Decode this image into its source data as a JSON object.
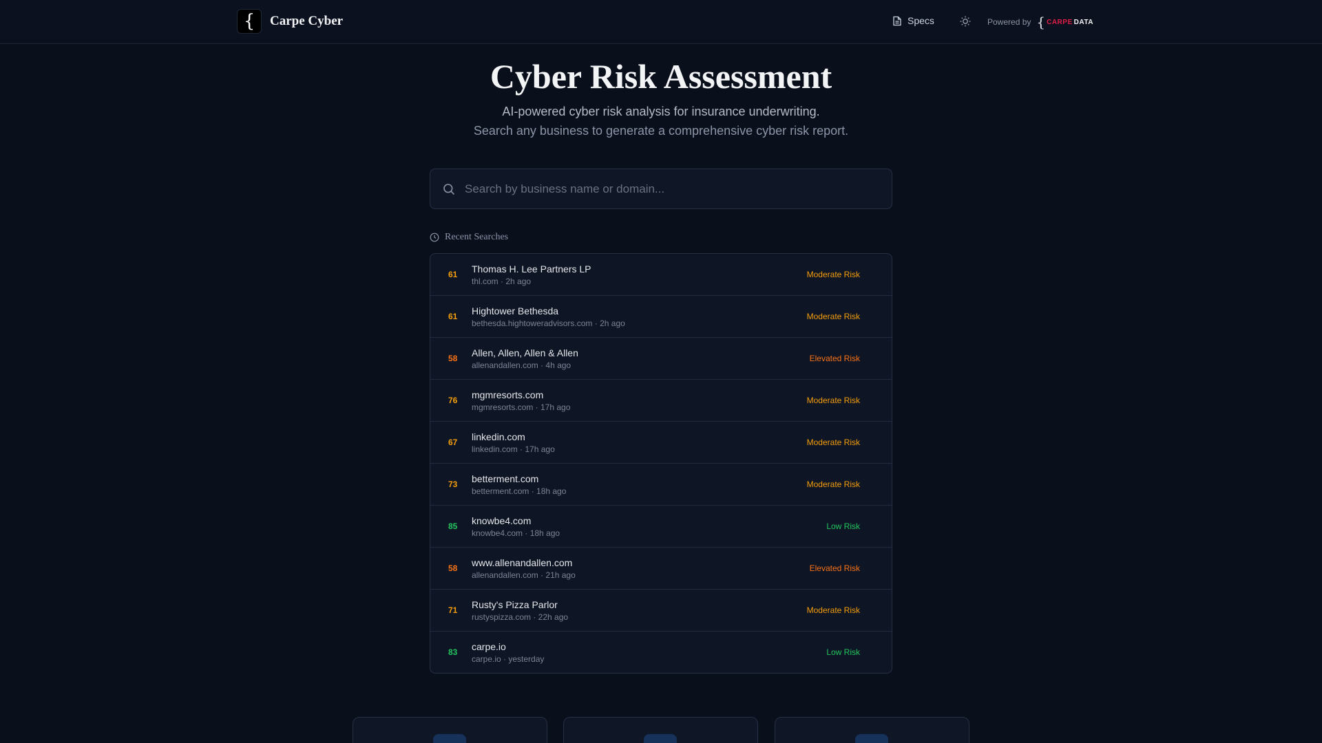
{
  "header": {
    "brand_mark": "{",
    "brand_name": "Carpe Cyber",
    "specs_label": "Specs",
    "powered_by": "Powered by",
    "powered_logo_brace": "{",
    "powered_logo_carpe": "CARPE",
    "powered_logo_data": "DATA"
  },
  "hero": {
    "title": "Cyber Risk Assessment",
    "subtitle_1": "AI-powered cyber risk analysis for insurance underwriting.",
    "subtitle_2": "Search any business to generate a comprehensive cyber risk report."
  },
  "search": {
    "placeholder": "Search by business name or domain...",
    "value": ""
  },
  "recent": {
    "label": "Recent Searches",
    "items": [
      {
        "score": "61",
        "name": "Thomas H. Lee Partners LP",
        "meta": "thl.com · 2h ago",
        "risk": "Moderate Risk"
      },
      {
        "score": "61",
        "name": "Hightower Bethesda",
        "meta": "bethesda.hightoweradvisors.com · 2h ago",
        "risk": "Moderate Risk"
      },
      {
        "score": "58",
        "name": "Allen, Allen, Allen & Allen",
        "meta": "allenandallen.com · 4h ago",
        "risk": "Elevated Risk"
      },
      {
        "score": "76",
        "name": "mgmresorts.com",
        "meta": "mgmresorts.com · 17h ago",
        "risk": "Moderate Risk"
      },
      {
        "score": "67",
        "name": "linkedin.com",
        "meta": "linkedin.com · 17h ago",
        "risk": "Moderate Risk"
      },
      {
        "score": "73",
        "name": "betterment.com",
        "meta": "betterment.com · 18h ago",
        "risk": "Moderate Risk"
      },
      {
        "score": "85",
        "name": "knowbe4.com",
        "meta": "knowbe4.com · 18h ago",
        "risk": "Low Risk"
      },
      {
        "score": "58",
        "name": "www.allenandallen.com",
        "meta": "allenandallen.com · 21h ago",
        "risk": "Elevated Risk"
      },
      {
        "score": "71",
        "name": "Rusty's Pizza Parlor",
        "meta": "rustyspizza.com · 22h ago",
        "risk": "Moderate Risk"
      },
      {
        "score": "83",
        "name": "carpe.io",
        "meta": "carpe.io · yesterday",
        "risk": "Low Risk"
      }
    ]
  },
  "colors": {
    "moderate": "#f59e0b",
    "elevated": "#f97316",
    "low": "#22c55e",
    "background": "#0a0f1c",
    "accent_red": "#e11d48"
  },
  "icons": {
    "specs": "document-icon",
    "theme": "sun-icon",
    "search": "search-icon",
    "recent": "clock-icon"
  }
}
